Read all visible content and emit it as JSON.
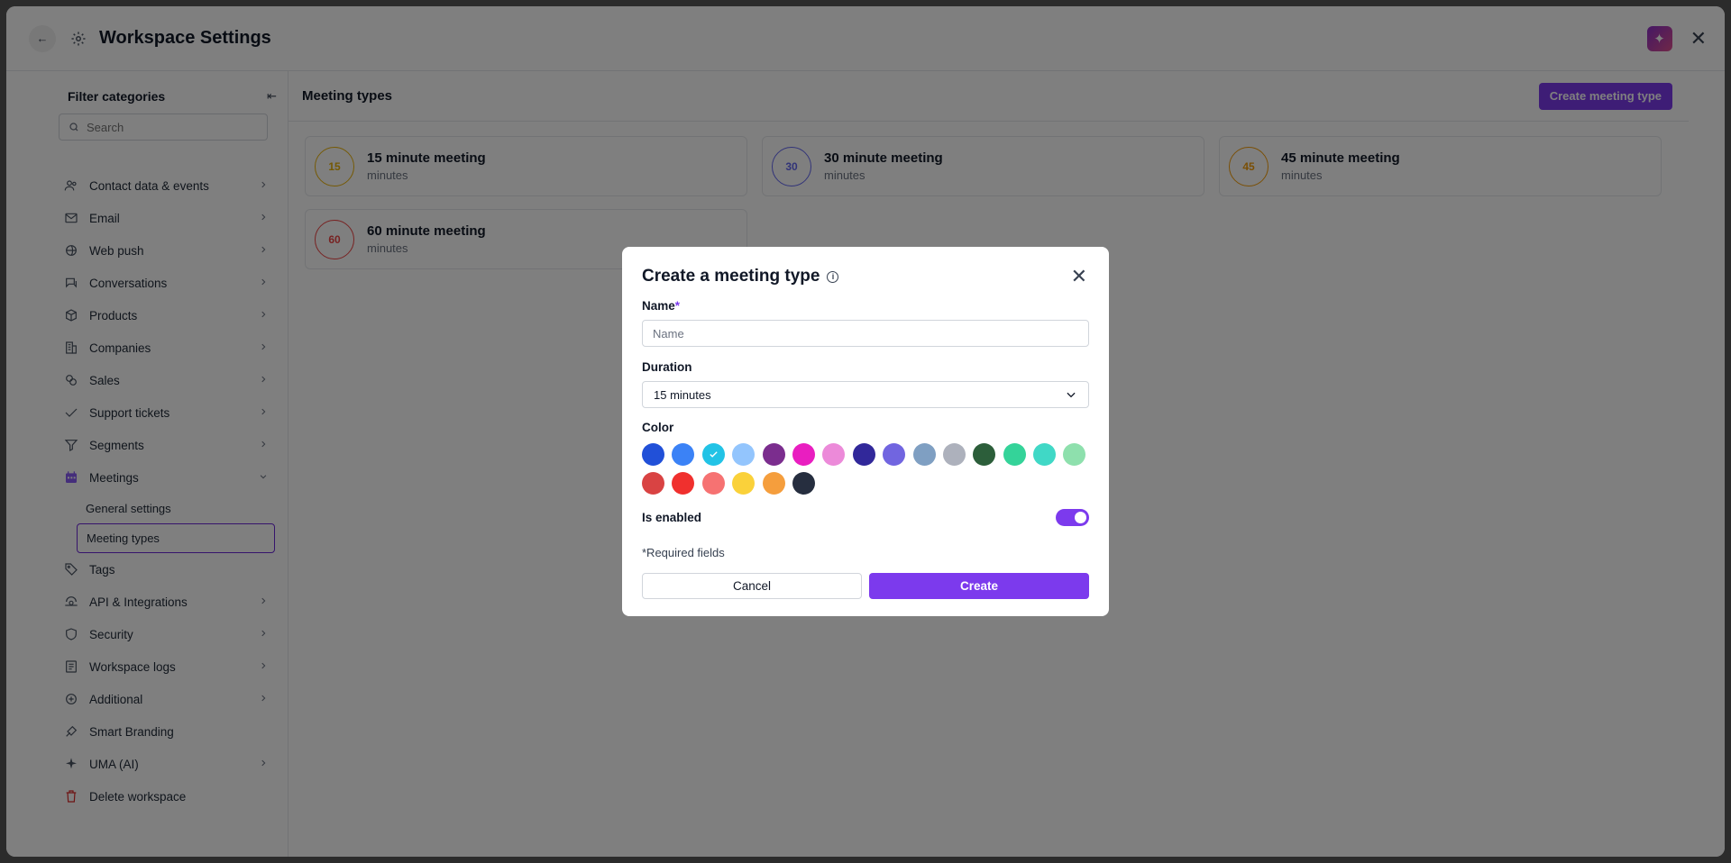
{
  "window": {
    "title": "Workspace Settings",
    "back_icon": "arrow-left-icon",
    "gear_icon": "gear-icon",
    "ai_icon": "sparkle-icon",
    "close_icon": "close-icon"
  },
  "sidebar": {
    "filter_title": "Filter categories",
    "search_placeholder": "Search",
    "items": [
      {
        "label": "Contact data & events",
        "icon": "contacts-icon",
        "chevron": true
      },
      {
        "label": "Email",
        "icon": "email-icon",
        "chevron": true
      },
      {
        "label": "Web push",
        "icon": "web-push-icon",
        "chevron": true
      },
      {
        "label": "Conversations",
        "icon": "conversations-icon",
        "chevron": true
      },
      {
        "label": "Products",
        "icon": "products-icon",
        "chevron": true
      },
      {
        "label": "Companies",
        "icon": "companies-icon",
        "chevron": true
      },
      {
        "label": "Sales",
        "icon": "sales-icon",
        "chevron": true
      },
      {
        "label": "Support tickets",
        "icon": "tickets-icon",
        "chevron": true
      },
      {
        "label": "Segments",
        "icon": "segments-icon",
        "chevron": true
      },
      {
        "label": "Meetings",
        "icon": "calendar-icon",
        "chevron": "down",
        "expanded": true,
        "children": [
          {
            "label": "General settings",
            "active": false
          },
          {
            "label": "Meeting types",
            "active": true
          }
        ]
      },
      {
        "label": "Tags",
        "icon": "tags-icon",
        "chevron": false
      },
      {
        "label": "API & Integrations",
        "icon": "api-icon",
        "chevron": true
      },
      {
        "label": "Security",
        "icon": "shield-icon",
        "chevron": true
      },
      {
        "label": "Workspace logs",
        "icon": "logs-icon",
        "chevron": true
      },
      {
        "label": "Additional",
        "icon": "additional-icon",
        "chevron": true
      },
      {
        "label": "Smart Branding",
        "icon": "branding-icon",
        "chevron": false
      },
      {
        "label": "UMA (AI)",
        "icon": "sparkle-icon",
        "chevron": true
      },
      {
        "label": "Delete workspace",
        "icon": "trash-icon",
        "chevron": false,
        "danger": true
      }
    ]
  },
  "main": {
    "title": "Meeting types",
    "create_label": "Create meeting type",
    "cards": [
      {
        "badge": "15",
        "name": "15 minute meeting",
        "sub": "minutes",
        "color": "#eab308"
      },
      {
        "badge": "30",
        "name": "30 minute meeting",
        "sub": "minutes",
        "color": "#6366f1"
      },
      {
        "badge": "45",
        "name": "45 minute meeting",
        "sub": "minutes",
        "color": "#f59e0b"
      },
      {
        "badge": "60",
        "name": "60 minute meeting",
        "sub": "minutes",
        "color": "#ef4444"
      }
    ]
  },
  "modal": {
    "title": "Create a meeting type",
    "name_label": "Name",
    "required_mark": "*",
    "name_value": "",
    "name_placeholder": "Name",
    "duration_label": "Duration",
    "duration_value": "15 minutes",
    "color_label": "Color",
    "colors": [
      "#2150d8",
      "#3b82f6",
      "#22c3e6",
      "#93c5fd",
      "#7b2d8e",
      "#e91ec0",
      "#ec8ad9",
      "#31289a",
      "#7165e0",
      "#7f9fc2",
      "#adb1bc",
      "#2c5e3a",
      "#34d399",
      "#40d8c6",
      "#8ee0ad",
      "#d94343",
      "#f0302e",
      "#f67272",
      "#fad13a",
      "#f59e3d",
      "#262e3f"
    ],
    "selected_color_index": 2,
    "enabled_label": "Is enabled",
    "enabled": true,
    "required_note": "*Required fields",
    "cancel_label": "Cancel",
    "create_label": "Create"
  }
}
